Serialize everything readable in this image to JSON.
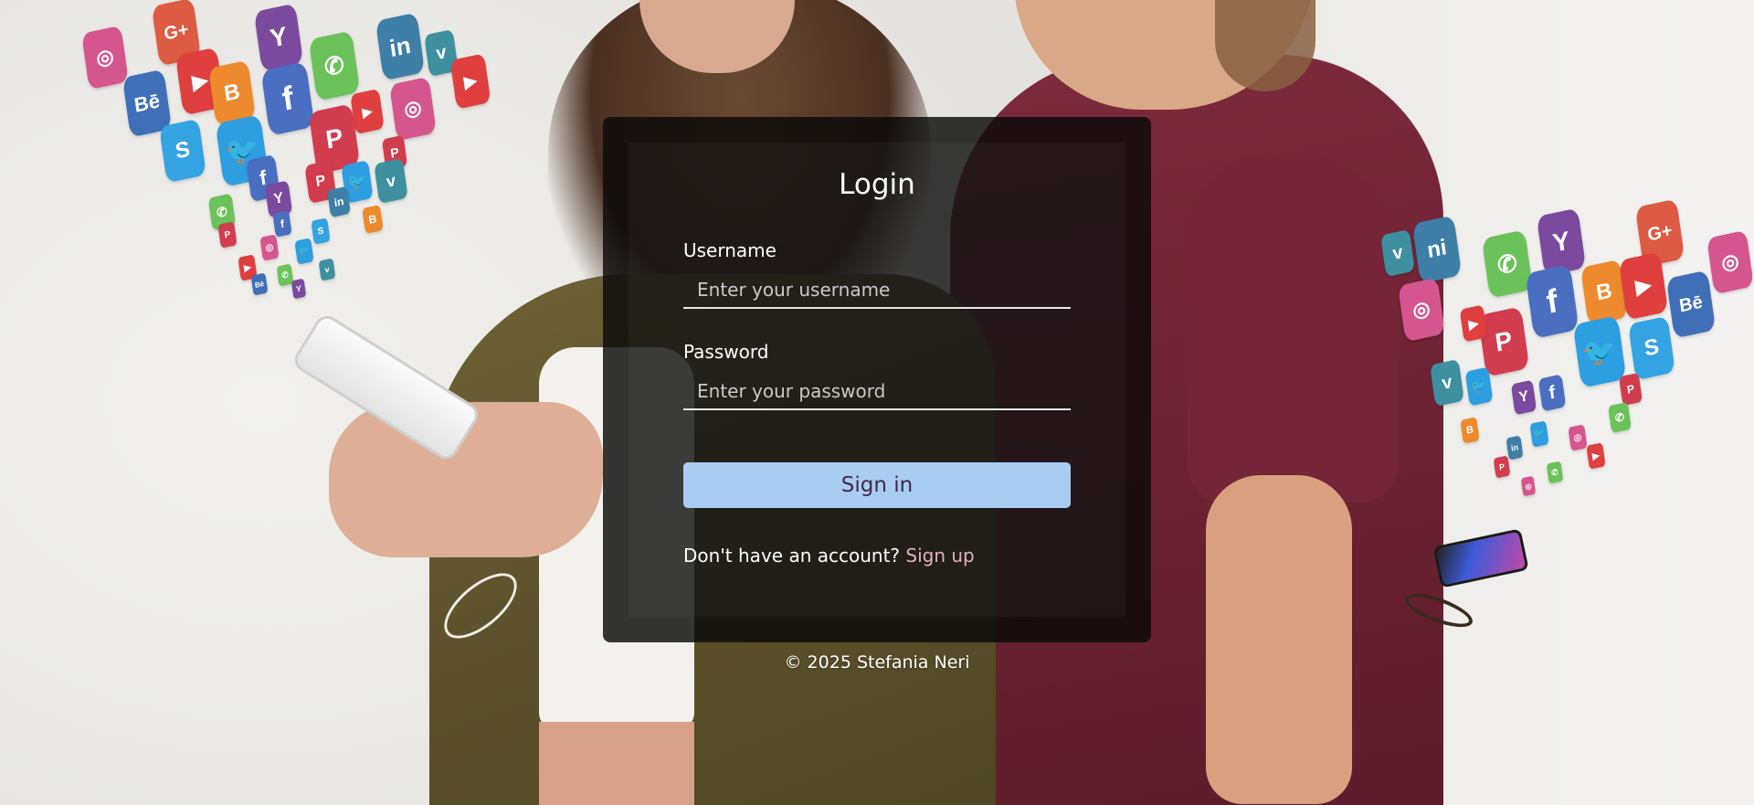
{
  "login": {
    "title": "Login",
    "username": {
      "label": "Username",
      "placeholder": "Enter your username",
      "value": ""
    },
    "password": {
      "label": "Password",
      "placeholder": "Enter your password",
      "value": ""
    },
    "signin_label": "Sign in",
    "signup_prompt": "Don't have an account?",
    "signup_link": "Sign up"
  },
  "footer": {
    "text": "© 2025 Stefania Neri"
  },
  "colors": {
    "card_background": "#0a0a0a",
    "button_background": "#a9cdf2",
    "button_text": "#42284d",
    "link": "#e0b0c0",
    "text": "#ffffff"
  },
  "background": {
    "description_icons": [
      "instagram-icon",
      "google-plus-icon",
      "youtube-icon",
      "yahoo-icon",
      "whatsapp-icon",
      "linkedin-icon",
      "vimeo-icon",
      "behance-icon",
      "blogger-icon",
      "facebook-icon",
      "twitter-icon",
      "pinterest-icon",
      "skype-icon"
    ]
  }
}
